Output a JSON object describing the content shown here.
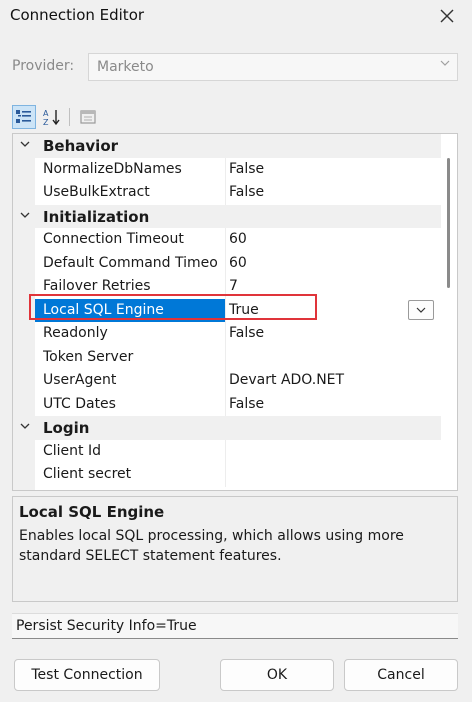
{
  "window": {
    "title": "Connection Editor"
  },
  "provider": {
    "label": "Provider:",
    "value": "Marketo"
  },
  "toolbar": {
    "icons": [
      "categorized-icon",
      "alphabetical-sort-icon",
      "property-pages-icon"
    ]
  },
  "grid": {
    "rows": [
      {
        "type": "category",
        "name": "Behavior"
      },
      {
        "type": "property",
        "name": "NormalizeDbNames",
        "value": "False"
      },
      {
        "type": "property",
        "name": "UseBulkExtract",
        "value": "False"
      },
      {
        "type": "category",
        "name": "Initialization"
      },
      {
        "type": "property",
        "name": "Connection Timeout",
        "value": "60"
      },
      {
        "type": "property",
        "name": "Default Command Timeo",
        "value": "60"
      },
      {
        "type": "property",
        "name": "Failover Retries",
        "value": "7"
      },
      {
        "type": "property",
        "name": "Local SQL Engine",
        "value": "True",
        "selected": true
      },
      {
        "type": "property",
        "name": "Readonly",
        "value": "False"
      },
      {
        "type": "property",
        "name": "Token Server",
        "value": ""
      },
      {
        "type": "property",
        "name": "UserAgent",
        "value": "Devart ADO.NET"
      },
      {
        "type": "property",
        "name": "UTC Dates",
        "value": "False"
      },
      {
        "type": "category",
        "name": "Login"
      },
      {
        "type": "property",
        "name": "Client Id",
        "value": ""
      },
      {
        "type": "property",
        "name": "Client secret",
        "value": ""
      }
    ]
  },
  "description": {
    "title": "Local SQL Engine",
    "text": "Enables local SQL processing, which allows using more standard SELECT statement features."
  },
  "connection_string": "Persist Security Info=True",
  "buttons": {
    "test": "Test Connection",
    "ok": "OK",
    "cancel": "Cancel"
  },
  "colors": {
    "selection": "#0078d7",
    "highlight_border": "#e0343a",
    "toolbar_active": "#cce4f7"
  }
}
